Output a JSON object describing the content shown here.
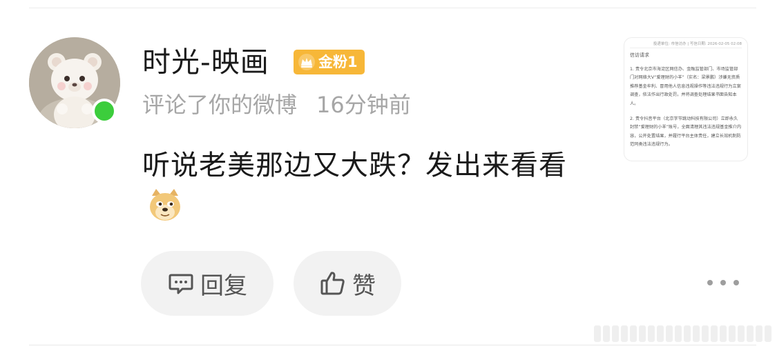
{
  "user": {
    "name": "时光-映画",
    "badge": "金粉1",
    "action": "评论了你的微博",
    "time": "16分钟前"
  },
  "comment": {
    "text": "听说老美那边又大跌？发出来看看",
    "emoji": "doge"
  },
  "buttons": {
    "reply": "回复",
    "like": "赞"
  },
  "thumbnail": {
    "header": "投递单位: 市信访办 | 写信日期: 2026-02-05 02:08",
    "title": "信访请求",
    "paragraph1": "1. 责令北京市海淀区网信办、金融监管部门、市场监管部门对网络大V“爱理财的小羊”（实名：梁景鹏）涉嫌无资质推荐基金牟利、冒用他人信息违规操作等违法违规行为立案调查，依法作出行政处罚，并将调查处理结果书面告知本人。",
    "paragraph2": "2. 责令抖音平台（北京字节跳动科技有限公司）立即永久封禁“爱理财的小羊”账号，全面清理其违法违规基金推介内容，公开处置结果，并履行平台主体责任，建立长效机制防范同类违法违规行为。"
  },
  "colors": {
    "online": "#3ccd3c",
    "badge": "#f7b738",
    "meta_text": "#a6a6a6",
    "button_bg": "#f2f2f2"
  },
  "icons": {
    "reply": "comment-bubble-icon",
    "like": "thumbs-up-icon",
    "more": "more-dots-icon",
    "badge": "crown-icon"
  }
}
